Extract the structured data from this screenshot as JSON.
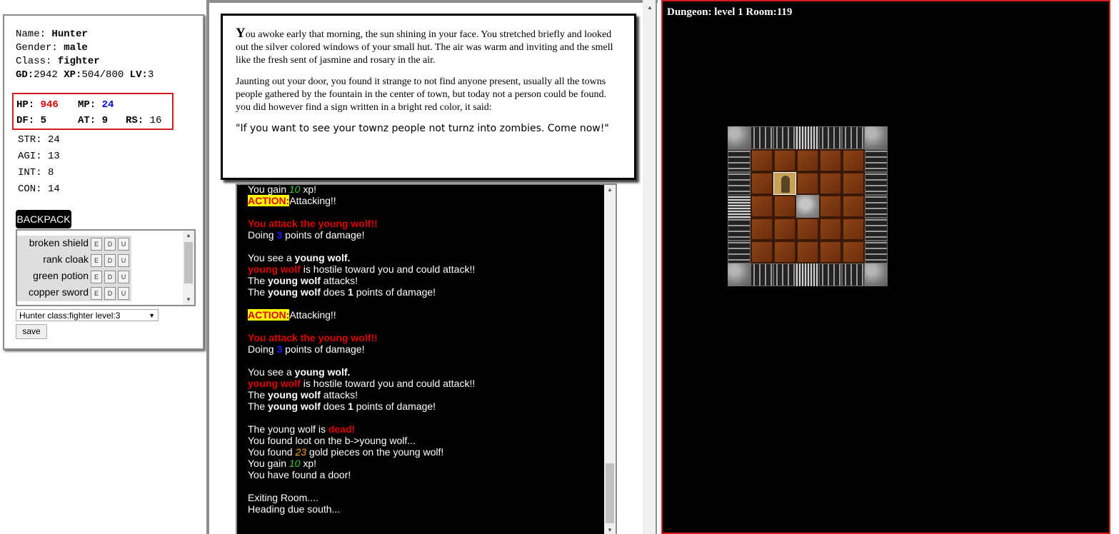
{
  "character": {
    "name_label": "Name:",
    "name": "Hunter",
    "gender_label": "Gender:",
    "gender": "male",
    "class_label": "Class:",
    "class": "fighter",
    "gd_label": "GD:",
    "gd": "2942",
    "xp_label": "XP:",
    "xp": "504/800",
    "lv_label": "LV:",
    "lv": "3",
    "hp_label": "HP:",
    "hp": "946",
    "mp_label": "MP:",
    "mp": "24",
    "df_label": "DF:",
    "df": "5",
    "at_label": "AT:",
    "at": "9",
    "rs_label": "RS:",
    "rs": "16",
    "str": "STR: 24",
    "agi": "AGI: 13",
    "int": "INT: 8",
    "con": "CON: 14"
  },
  "backpack": {
    "button": "BACKPACK",
    "items": [
      {
        "name": "broken shield",
        "e": "E",
        "d": "D",
        "u": "U"
      },
      {
        "name": "rank cloak",
        "e": "E",
        "d": "D",
        "u": "U"
      },
      {
        "name": "green potion",
        "e": "E",
        "d": "D",
        "u": "U"
      },
      {
        "name": "copper sword",
        "e": "E",
        "d": "D",
        "u": "U"
      }
    ]
  },
  "save": {
    "selected": "Hunter class:fighter level:3",
    "button": "save"
  },
  "story": {
    "p1_drop": "Y",
    "p1": "ou awoke early that morning, the sun shining in your face. You stretched briefly and looked out the silver colored windows of your small hut. The air was warm and inviting and the smell like the fresh sent of jasmine and rosary in the air.",
    "p2": "Jaunting out your door, you found it strange to not find anyone present, usually all the towns people gathered by the fountain in the center of town, but today not a person could be found. you did however find a sign written in a bright red color, it said:",
    "quote": "\"If you want to see your townz people not turnz into zombies. Come now!\""
  },
  "log": {
    "xp_gain_1": "10",
    "action_label": "ACTION:",
    "attacking": "Attacking!!",
    "attack_msg": "You attack the young wolf!!",
    "doing": "Doing",
    "dmg_1": "3",
    "points_of_damage": "points of damage!",
    "you_see": "You see a",
    "monster": "young wolf.",
    "hostile_name": "young wolf",
    "hostile_rest": "is hostile toward you and could attack!!",
    "the": "The",
    "monster_name": "young wolf",
    "attacks": "attacks!",
    "does": "does",
    "wolf_dmg": "1",
    "dmg_2": "3",
    "dead_pre": "The young wolf is",
    "dead_word": "dead!",
    "loot": "You found loot on the b->young wolf...",
    "gold_pre": "You found",
    "gold": "23",
    "gold_post": "gold pieces on the young wolf!",
    "gain_pre": "You gain",
    "xp_gain_2": "10",
    "gain_post": "xp!",
    "door": "You have found a door!",
    "exit": "Exiting Room....",
    "heading": "Heading due south..."
  },
  "dungeon": {
    "title": "Dungeon: level 1 Room:119"
  }
}
